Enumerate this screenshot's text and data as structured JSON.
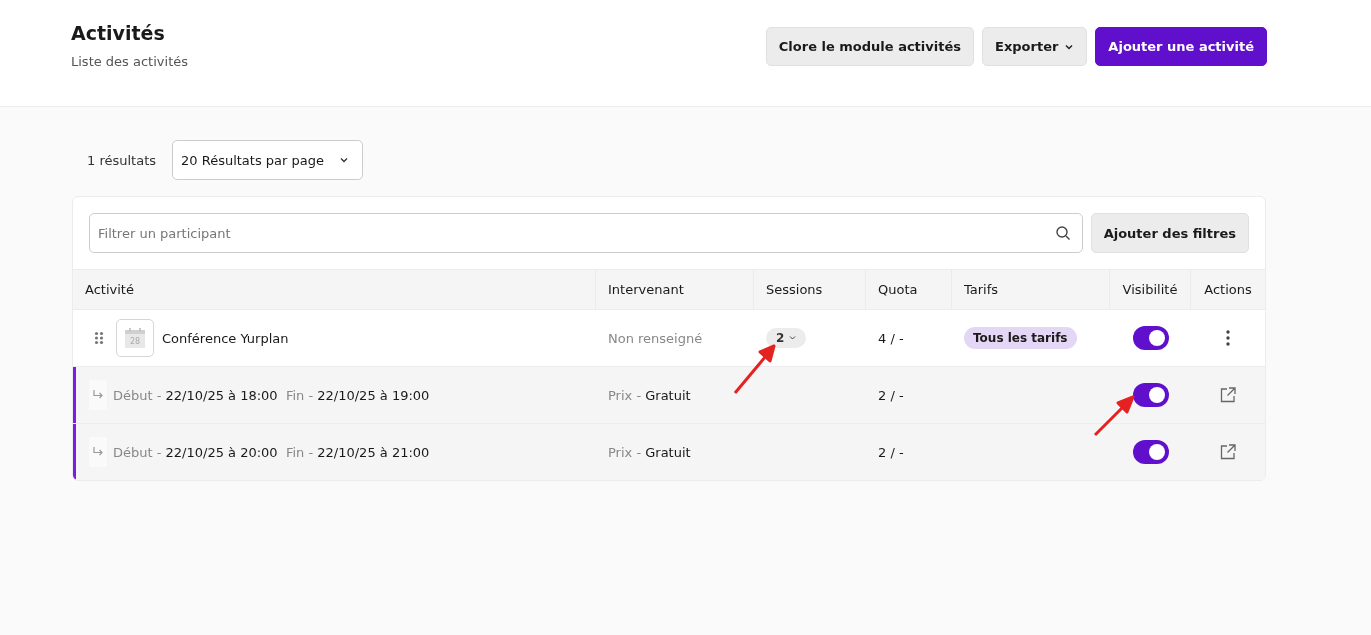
{
  "header": {
    "title": "Activités",
    "subtitle": "Liste des activités",
    "buttons": [
      {
        "label": "Clore le module activités",
        "kind": "secondary"
      },
      {
        "label": "Exporter",
        "kind": "dropdown"
      },
      {
        "label": "Ajouter une activité",
        "kind": "primary"
      }
    ]
  },
  "results": {
    "count": "1 résultats",
    "per_page": "20 Résultats par page"
  },
  "filter": {
    "placeholder": "Filtrer un participant",
    "button": "Ajouter des filtres"
  },
  "table": {
    "columns": [
      "Activité",
      "Intervenant",
      "Sessions",
      "Quota",
      "Tarifs",
      "Visibilité",
      "Actions"
    ],
    "rows": [
      {
        "kind": "activity",
        "calendar_day": "28",
        "name": "Conférence Yurplan",
        "intervenant": "Non renseigné",
        "sessions": "2",
        "quota": "4 / -",
        "tarif": "Tous les tarifs",
        "visible": true
      },
      {
        "kind": "session",
        "dates": "Début - **22/10/25 à 18:00**  Fin - **22/10/25 à 19:00**",
        "price": "Prix - **Gratuit**",
        "quota": "2 / -",
        "visible": true
      },
      {
        "kind": "session",
        "dates": "Début - **22/10/25 à 20:00**  Fin - **22/10/25 à 21:00**",
        "price": "Prix - **Gratuit**",
        "quota": "2 / -",
        "visible": true
      }
    ]
  }
}
